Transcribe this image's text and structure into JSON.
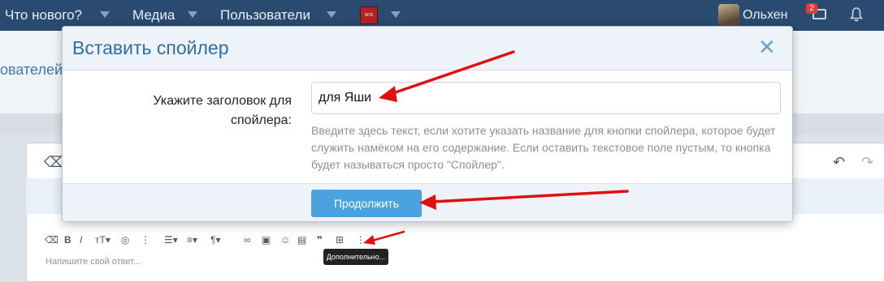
{
  "nav": {
    "items": [
      "Что нового?",
      "Медиа",
      "Пользователи"
    ],
    "thumb_text": "SOS",
    "username": "Ольхен",
    "badge_count": "2"
  },
  "background": {
    "partial_text": "ователей"
  },
  "modal": {
    "title": "Вставить спойлер",
    "close_symbol": "✕",
    "label": "Укажите заголовок для спойлера:",
    "input_value": "для Яши",
    "hint": "Введите здесь текст, если хотите указать название для кнопки спойлера, которое будет служить намёком на его содержание. Если оставить текстовое поле пустым, то кнопка будет называться просто \"Спойлер\".",
    "continue_label": "Продолжить"
  },
  "editor": {
    "placeholder": "Напишите свой ответ...",
    "tooltip": "Дополнительно..."
  },
  "colors": {
    "nav_bg": "#2a4a70",
    "accent": "#4aa3e0",
    "title": "#2f6da5",
    "arrow": "#e01010"
  }
}
